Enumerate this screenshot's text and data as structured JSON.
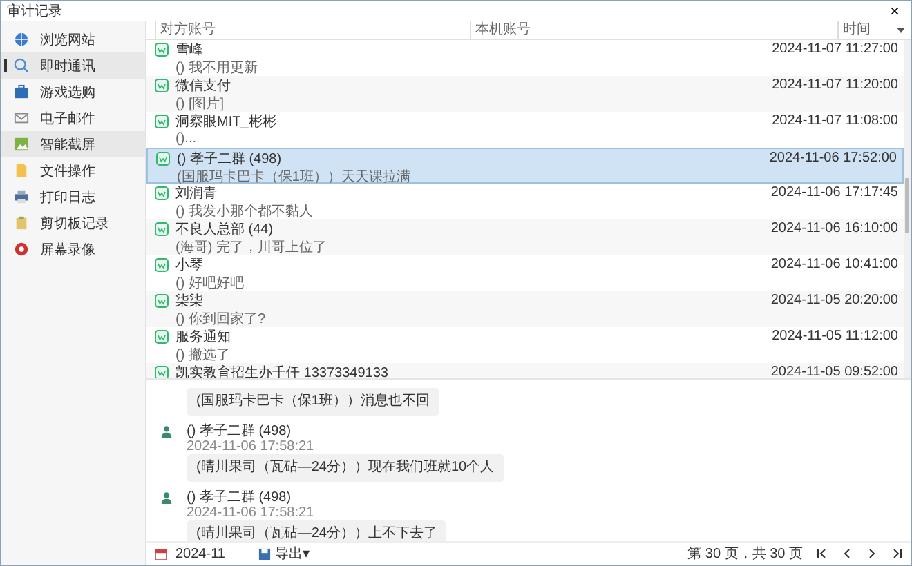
{
  "window": {
    "title": "审计记录",
    "close": "×"
  },
  "sidebar": {
    "items": [
      {
        "label": "浏览网站",
        "selected": false,
        "highlighted": false
      },
      {
        "label": "即时通讯",
        "selected": true,
        "highlighted": true
      },
      {
        "label": "游戏选购",
        "selected": false,
        "highlighted": false
      },
      {
        "label": "电子邮件",
        "selected": false,
        "highlighted": false
      },
      {
        "label": "智能截屏",
        "selected": false,
        "highlighted": true
      },
      {
        "label": "文件操作",
        "selected": false,
        "highlighted": false
      },
      {
        "label": "打印日志",
        "selected": false,
        "highlighted": false
      },
      {
        "label": "剪切板记录",
        "selected": false,
        "highlighted": false
      },
      {
        "label": "屏幕录像",
        "selected": false,
        "highlighted": false
      }
    ]
  },
  "table": {
    "columns": [
      "对方账号",
      "本机账号",
      "时间"
    ],
    "rows": [
      {
        "name": "雪峰",
        "preview": "() 我不用更新",
        "time": "2024-11-07 11:27:00",
        "selected": false
      },
      {
        "name": "微信支付",
        "preview": "() [图片]",
        "time": "2024-11-07 11:20:00",
        "selected": false
      },
      {
        "name": "洞察眼MIT_彬彬",
        "preview": "()...",
        "time": "2024-11-07 11:08:00",
        "selected": false
      },
      {
        "name": "() 孝子二群 (498)",
        "preview": "(国服玛卡巴卡（保1班））天天课拉满",
        "time": "2024-11-06 17:52:00",
        "selected": true
      },
      {
        "name": "刘润青",
        "preview": "() 我发小那个都不黏人",
        "time": "2024-11-06 17:17:45",
        "selected": false
      },
      {
        "name": "不良人总部 (44)",
        "preview": "(海哥) 完了，川哥上位了",
        "time": "2024-11-06 16:10:00",
        "selected": false
      },
      {
        "name": "小琴",
        "preview": "() 好吧好吧",
        "time": "2024-11-06 10:41:00",
        "selected": false
      },
      {
        "name": "柒柒",
        "preview": "() 你到回家了?",
        "time": "2024-11-05 20:20:00",
        "selected": false
      },
      {
        "name": "服务通知",
        "preview": "() 撤选了",
        "time": "2024-11-05 11:12:00",
        "selected": false
      },
      {
        "name": "凯实教育招生办千仟 13373349133",
        "time": "2024-11-05 09:52:00",
        "selected": false
      }
    ]
  },
  "chat": {
    "messages": [
      {
        "text": "(国服玛卡巴卡（保1班））消息也不回"
      },
      {
        "sender": "() 孝子二群 (498)",
        "time": "2024-11-06 17:58:21",
        "text": "(晴川果司（瓦砧—24分））现在我们班就10个人"
      },
      {
        "sender": "() 孝子二群 (498)",
        "time": "2024-11-06 17:58:21",
        "text": "(晴川果司（瓦砧—24分））上不下去了"
      }
    ]
  },
  "footer": {
    "month": "2024-11",
    "export": "导出▾",
    "pages": "第 30 页，共 30 页"
  }
}
